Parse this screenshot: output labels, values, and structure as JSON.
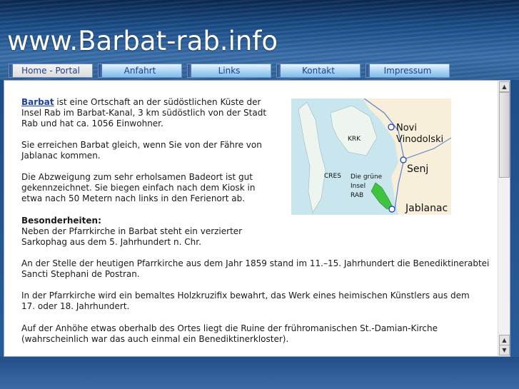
{
  "header": {
    "site_title": "www.Barbat-rab.info"
  },
  "nav": {
    "items": [
      "Home - Portal",
      "Anfahrt",
      "Links",
      "Kontakt",
      "Impressum"
    ],
    "active": "Home - Portal"
  },
  "content": {
    "intro_link": "Barbat",
    "intro_line1": "ist eine Ortschaft an der südöstlichen Küste der",
    "intro_line2": "Insel Rab im Barbat-Kanal, 3 km südöstlich von der Stadt",
    "intro_line3": "Rab und hat  ca. 1056 Einwohner.",
    "ferry_line1": "Sie erreichen Barbat gleich, wenn Sie von der Fähre von",
    "ferry_line2": "Jablanac kommen.",
    "turn_line1": "Die Abzweigung zum sehr erholsamen Badeort ist gut",
    "turn_line2": "gekennzeichnet. Sie biegen einfach nach dem Kiosk in",
    "turn_line3": "etwa nach 50 Metern nach links in den Ferienort ab.",
    "features_heading": "Besonderheiten:",
    "features_line1": "Neben der Pfarrkirche in Barbat steht ein verzierter",
    "features_line2": "Sarkophag aus dem 5. Jahrhundert n. Chr.",
    "church_line1": "An der Stelle der heutigen Pfarrkirche aus dem Jahr 1859 stand im 11.–15. Jahrhundert die Benediktinerabtei",
    "church_line2": "Sancti Stephani de Postran.",
    "crucifix_line1": "In der Pfarrkirche wird ein bemaltes Holzkruzifix bewahrt, das Werk eines heimischen Künstlers aus dem",
    "crucifix_line2": "17. oder 18. Jahrhundert.",
    "ruin_line1": "Auf der Anhöhe etwas oberhalb des Ortes liegt die Ruine der frühromanischen St.-Damian-Kirche",
    "ruin_line2": "(wahrscheinlich war das auch einmal ein Benediktinerkloster)."
  },
  "map": {
    "labels": {
      "novi": "Novi",
      "vinodolski": "Vinodolski",
      "krk": "KRK",
      "senj": "Senj",
      "cres": "CRES",
      "green1": "Die grüne",
      "green2": "Insel",
      "rab": "RAB",
      "jablanac": "Jablanac"
    },
    "colors": {
      "sea": "#c9e6ee",
      "land": "#f7efd9",
      "island": "#3fc43f",
      "road": "#5a7fd6"
    }
  }
}
